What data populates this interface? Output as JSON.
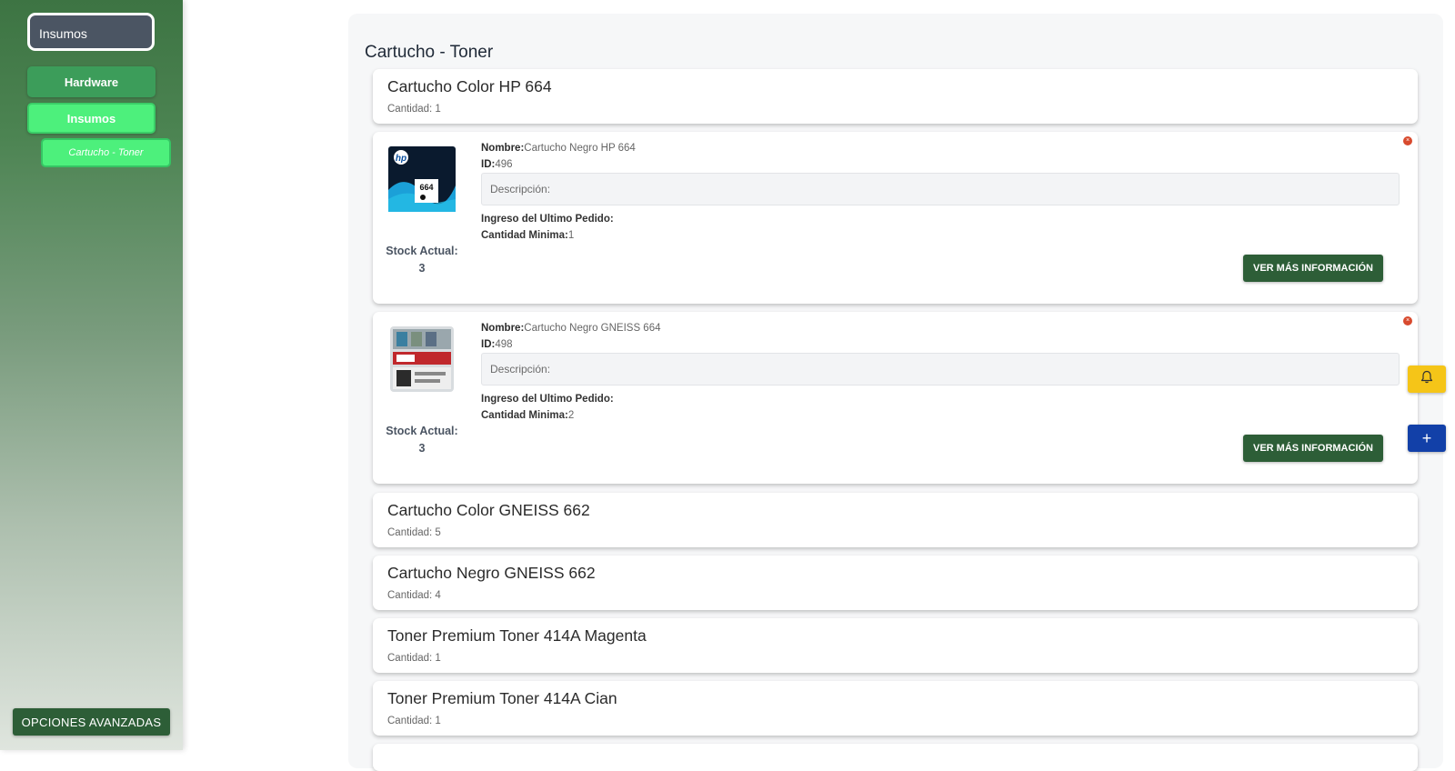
{
  "sidebar": {
    "select_value": "Insumos",
    "items": [
      {
        "label": "Hardware"
      },
      {
        "label": "Insumos"
      }
    ],
    "sub_item": "Cartucho - Toner",
    "advanced_label": "OPCIONES AVANZADAS"
  },
  "main": {
    "title": "Cartucho - Toner",
    "cards": [
      {
        "title": "Cartucho Color HP 664",
        "quantity": "Cantidad: 1"
      },
      {
        "title": "Cartucho Color GNEISS 662",
        "quantity": "Cantidad: 5"
      },
      {
        "title": "Cartucho Negro GNEISS 662",
        "quantity": "Cantidad: 4"
      },
      {
        "title": "Toner Premium Toner 414A Magenta",
        "quantity": "Cantidad: 1"
      },
      {
        "title": "Toner Premium Toner 414A Cian",
        "quantity": "Cantidad: 1"
      }
    ],
    "labels": {
      "nombre": "Nombre:",
      "id": "ID:",
      "ingreso": "Ingreso del Ultimo Pedido:",
      "cantidad_minima": "Cantidad Minima:",
      "stock": "Stock Actual:",
      "description_placeholder": "Descripción:",
      "more_button": "VER MÁS INFORMACIÓN"
    },
    "details": [
      {
        "nombre": "Cartucho Negro HP 664",
        "id": "496",
        "cantidad_minima": "1",
        "stock": "3",
        "thumb_text": "664"
      },
      {
        "nombre": "Cartucho Negro GNEISS 664",
        "id": "498",
        "cantidad_minima": "2",
        "stock": "3"
      }
    ]
  },
  "fab": {
    "bell_icon": "bell-icon",
    "plus_icon": "plus-icon",
    "plus_symbol": "+"
  },
  "colors": {
    "accent_dark_green": "#2d5e37",
    "active_green": "#4df07c",
    "bell_yellow": "#f5c518",
    "plus_blue": "#1240a8",
    "close_red": "#d84a2e"
  }
}
